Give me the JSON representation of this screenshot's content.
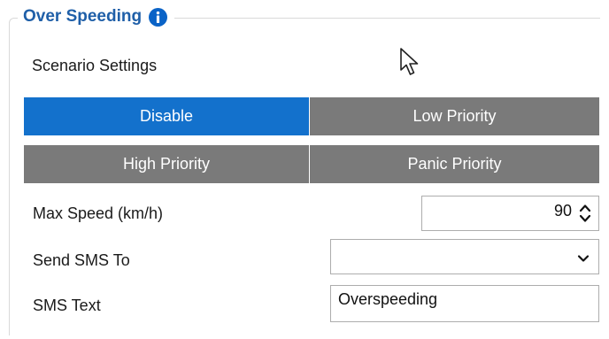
{
  "group": {
    "title": "Over Speeding",
    "info_icon": "info-icon",
    "accent_color": "#1f5fa8"
  },
  "scenario": {
    "label": "Scenario Settings",
    "options": [
      {
        "label": "Disable",
        "selected": true
      },
      {
        "label": "Low Priority",
        "selected": false
      },
      {
        "label": "High Priority",
        "selected": false
      },
      {
        "label": "Panic Priority",
        "selected": false
      }
    ],
    "selected_color": "#1371cc",
    "unselected_color": "#7a7a7a"
  },
  "max_speed": {
    "label": "Max Speed  (km/h)",
    "value": "90"
  },
  "send_sms": {
    "label": "Send SMS To",
    "value": ""
  },
  "sms_text": {
    "label": "SMS Text",
    "value": "Overspeeding"
  }
}
